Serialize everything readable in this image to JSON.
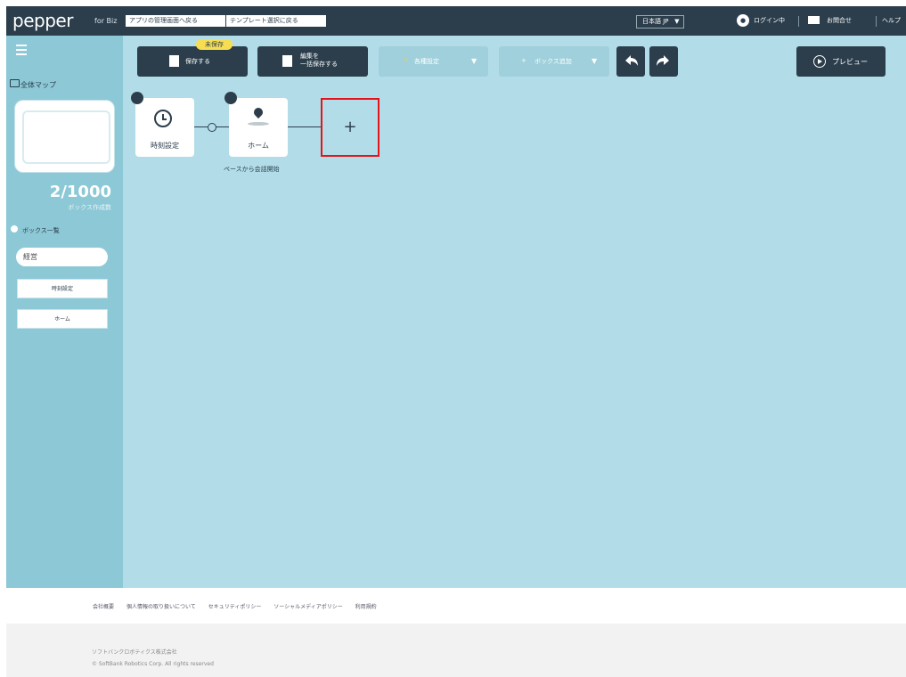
{
  "header": {
    "brand": "pepper",
    "brand_sub": "for Biz",
    "link_app_mgmt": "アプリの管理画面へ戻る",
    "link_template": "テンプレート選択に戻る",
    "language": "日本語 JP",
    "login": "ログイン中",
    "contact": "お問合せ",
    "help": "ヘルプ"
  },
  "sidebar": {
    "title": "全体マップ",
    "count": "2/1000",
    "count_label": "ボックス作成数",
    "box_list_title": "ボックス一覧",
    "search_value": "経営",
    "items": [
      {
        "label": "時刻設定"
      },
      {
        "label": "ホーム"
      }
    ]
  },
  "toolbar": {
    "badge": "未保存",
    "save": "保存する",
    "save_all_line1": "編集を",
    "save_all_line2": "一括保存する",
    "settings": "各種設定",
    "box_add": "ボックス追加",
    "preview": "プレビュー"
  },
  "canvas": {
    "nodes": [
      {
        "label": "時刻設定",
        "icon": "clock-icon"
      },
      {
        "label": "ホーム",
        "icon": "location-pin-icon",
        "sub": "ペースから会話開始"
      }
    ],
    "add_label": "+"
  },
  "footer": {
    "links": [
      "会社概要",
      "個人情報の取り扱いについて",
      "セキュリティポリシー",
      "ソーシャルメディアポリシー",
      "利用規約"
    ],
    "company": "ソフトバンクロボティクス株式会社",
    "copyright": "© SoftBank Robotics Corp. All rights reserved"
  },
  "colors": {
    "canvas": "#b2dde8",
    "sidebar": "#8cc8d6",
    "dark": "#2c3e4c",
    "badge": "#f7dd52",
    "highlight": "#e3141b"
  }
}
